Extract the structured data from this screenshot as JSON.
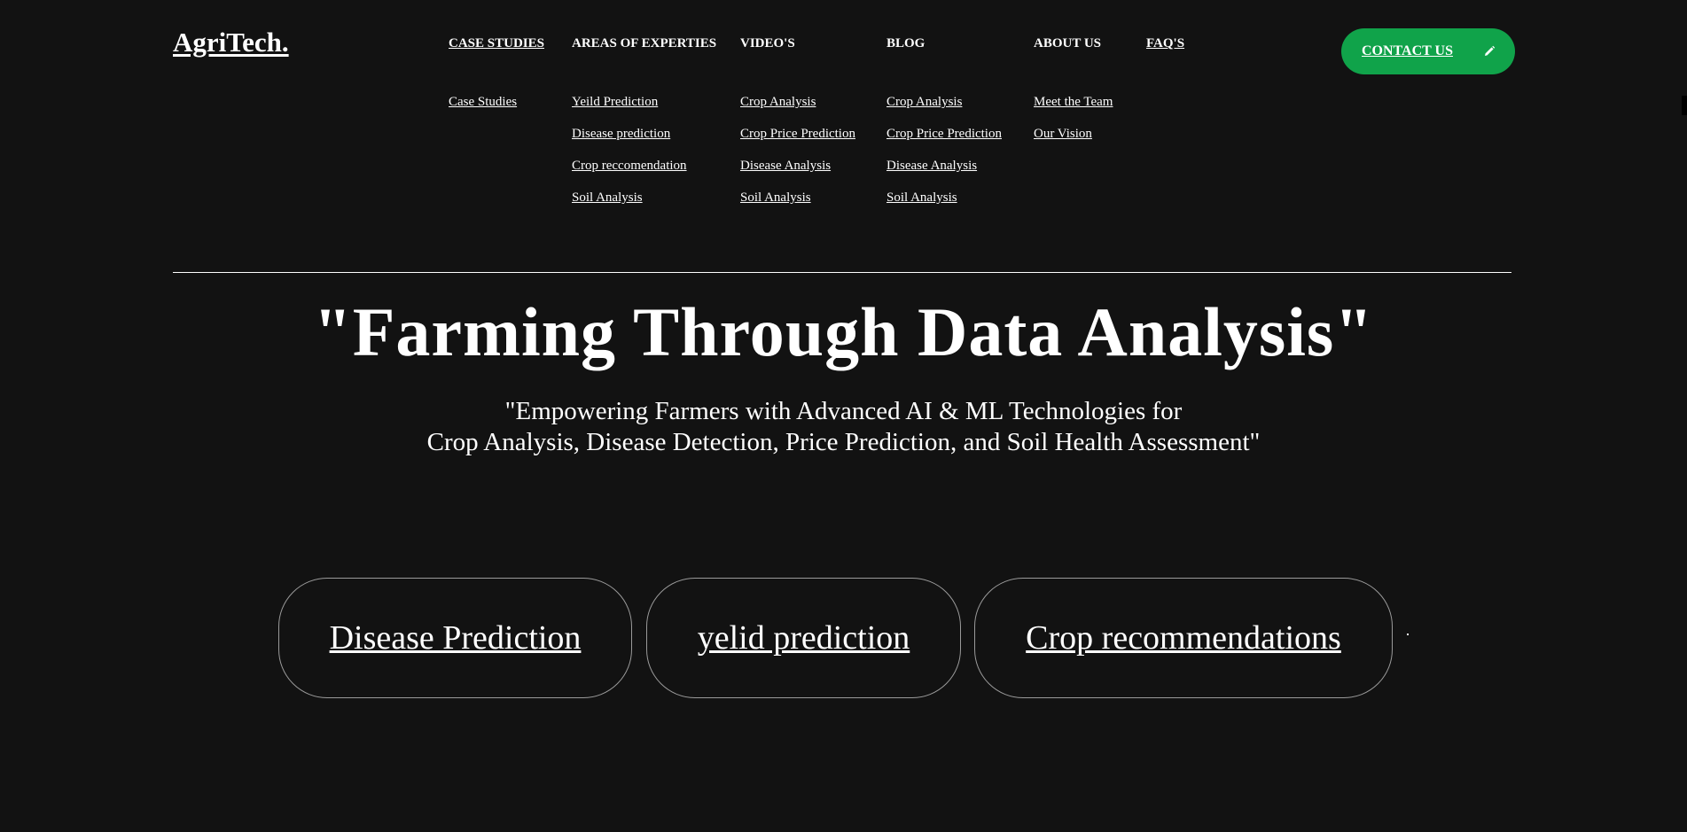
{
  "logo": "AgriTech.",
  "nav": {
    "columns": [
      {
        "heading": "CASE STUDIES",
        "links": [
          "Case Studies"
        ]
      },
      {
        "heading": "AREAS OF EXPERTIES",
        "links": [
          "Yeild Prediction",
          "Disease prediction",
          "Crop reccomendation",
          "Soil Analysis"
        ]
      },
      {
        "heading": "VIDEO'S",
        "links": [
          "Crop Analysis",
          "Crop Price Prediction",
          "Disease Analysis",
          "Soil Analysis"
        ]
      },
      {
        "heading": "BLOG",
        "links": [
          "Crop Analysis",
          "Crop Price Prediction",
          "Disease Analysis",
          "Soil Analysis"
        ]
      },
      {
        "heading": "ABOUT US",
        "links": [
          "Meet the Team",
          "Our Vision"
        ]
      },
      {
        "heading": "FAQ'S",
        "links": []
      }
    ]
  },
  "contact": {
    "label": "CONTACT US",
    "icon": "pencil-icon",
    "color": "#10a34a"
  },
  "hero": {
    "title": "\"Farming Through Data Analysis\"",
    "subtitle_line1": "\"Empowering Farmers with Advanced AI & ML Technologies for",
    "subtitle_line2": "Crop Analysis, Disease Detection, Price Prediction, and Soil Health Assessment\""
  },
  "features": [
    {
      "label": "Disease Prediction"
    },
    {
      "label": "yelid prediction"
    },
    {
      "label": "Crop recommendations"
    }
  ],
  "colors": {
    "background": "#121212",
    "text": "#ffffff",
    "accent": "#10a34a"
  }
}
